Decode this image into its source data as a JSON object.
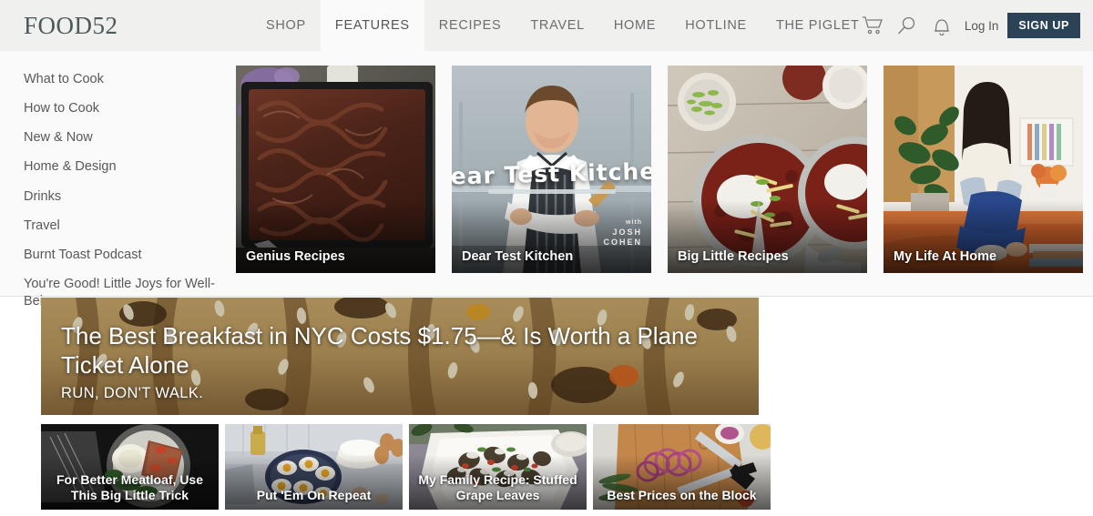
{
  "header": {
    "logo": "FOOD52",
    "nav": [
      {
        "label": "SHOP",
        "active": false
      },
      {
        "label": "FEATURES",
        "active": true
      },
      {
        "label": "RECIPES",
        "active": false
      },
      {
        "label": "TRAVEL",
        "active": false
      },
      {
        "label": "HOME",
        "active": false
      },
      {
        "label": "HOTLINE",
        "active": false
      },
      {
        "label": "THE PIGLET",
        "active": false
      }
    ],
    "icons": [
      "cart-icon",
      "search-icon",
      "bell-icon"
    ],
    "login_label": "Log In",
    "signup_label": "SIGN UP",
    "signup_color": "#2b4257",
    "background": "#f0f0ef"
  },
  "dropdown": {
    "links": [
      "What to Cook",
      "How to Cook",
      "New & Now",
      "Home & Design",
      "Drinks",
      "Travel",
      "Burnt Toast Podcast",
      "You're Good! Little Joys for Well-Being"
    ],
    "cards": [
      {
        "label": "Genius Recipes",
        "image": "chocolate-brownies-in-pan"
      },
      {
        "label": "Dear Test Kitchen",
        "image": "chef-in-striped-apron",
        "script": "Dear Test Kitchen",
        "credit_with": "with",
        "credit_name": "JOSH\nCOHEN"
      },
      {
        "label": "Big Little Recipes",
        "image": "chili-bowls-on-wood-table"
      },
      {
        "label": "My Life At Home",
        "image": "woman-on-orange-sofa"
      }
    ]
  },
  "hero": {
    "title": "The Best Breakfast in NYC Costs $1.75—& Is Worth a Plane Ticket Alone",
    "subtitle": "RUN, DON'T WALK.",
    "image": "sesame-bagel-sandwich-closeup"
  },
  "thumbnails": [
    {
      "label": "For Better Meatloaf, Use This Big Little Trick",
      "image": "meatloaf-plate-dark"
    },
    {
      "label": "Put 'Em On Repeat",
      "image": "fried-eggs-in-skillet"
    },
    {
      "label": "My Family Recipe: Stuffed Grape Leaves",
      "image": "stuffed-grape-leaves-platter"
    },
    {
      "label": "Best Prices on the Block",
      "image": "sliced-red-onion-cutting-board"
    }
  ]
}
